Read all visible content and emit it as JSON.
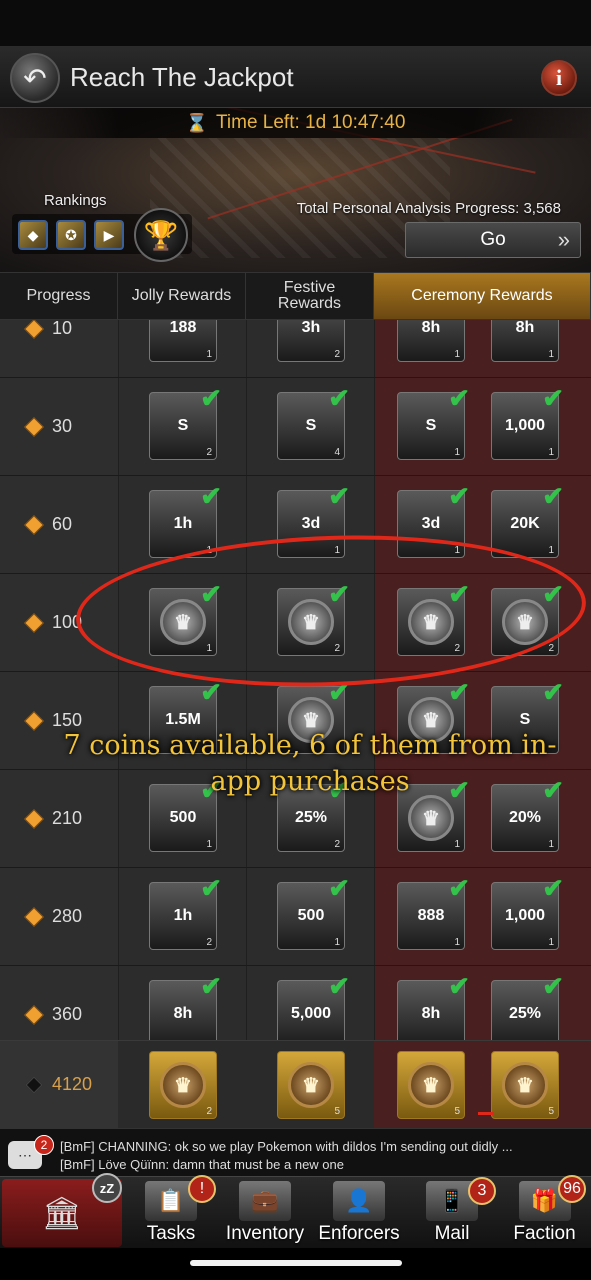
{
  "header": {
    "title": "Reach The Jackpot",
    "back_icon": "back-arrow-icon",
    "info_icon": "info-icon"
  },
  "banner": {
    "timer": "Time Left: 1d 10:47:40",
    "rankings_label": "Rankings",
    "progress_text": "Total Personal Analysis Progress: 3,568",
    "go_label": "Go"
  },
  "tabs": [
    {
      "label": "Progress"
    },
    {
      "label": "Jolly Rewards"
    },
    {
      "label": "Festive Rewards"
    },
    {
      "label": "Ceremony Rewards"
    }
  ],
  "rows": [
    {
      "threshold": "10",
      "items": [
        {
          "label": "188",
          "qty": "1",
          "claimed": true
        },
        {
          "label": "3h",
          "qty": "2",
          "claimed": true
        },
        {
          "label": "8h",
          "qty": "1",
          "claimed": true
        },
        {
          "label": "8h",
          "qty": "1",
          "claimed": true
        }
      ]
    },
    {
      "threshold": "30",
      "items": [
        {
          "label": "S",
          "qty": "2",
          "claimed": true
        },
        {
          "label": "S",
          "qty": "4",
          "claimed": true
        },
        {
          "label": "S",
          "qty": "1",
          "claimed": true
        },
        {
          "label": "1,000",
          "qty": "1",
          "claimed": true
        }
      ]
    },
    {
      "threshold": "60",
      "items": [
        {
          "label": "1h",
          "qty": "1",
          "claimed": true
        },
        {
          "label": "3d",
          "qty": "1",
          "claimed": true
        },
        {
          "label": "3d",
          "qty": "1",
          "claimed": true
        },
        {
          "label": "20K",
          "qty": "1",
          "claimed": true
        }
      ]
    },
    {
      "threshold": "100",
      "items": [
        {
          "label": "",
          "qty": "1",
          "claimed": true
        },
        {
          "label": "",
          "qty": "2",
          "claimed": true
        },
        {
          "label": "",
          "qty": "2",
          "claimed": true
        },
        {
          "label": "",
          "qty": "2",
          "claimed": true
        }
      ]
    },
    {
      "threshold": "150",
      "items": [
        {
          "label": "1.5M",
          "qty": "",
          "claimed": true
        },
        {
          "label": "",
          "qty": "",
          "claimed": true
        },
        {
          "label": "",
          "qty": "",
          "claimed": true
        },
        {
          "label": "S",
          "qty": "",
          "claimed": true
        }
      ]
    },
    {
      "threshold": "210",
      "items": [
        {
          "label": "500",
          "qty": "1",
          "claimed": true
        },
        {
          "label": "25%",
          "qty": "2",
          "claimed": true
        },
        {
          "label": "",
          "qty": "1",
          "claimed": true
        },
        {
          "label": "20%",
          "qty": "1",
          "claimed": true
        }
      ]
    },
    {
      "threshold": "280",
      "items": [
        {
          "label": "1h",
          "qty": "2",
          "claimed": true
        },
        {
          "label": "500",
          "qty": "1",
          "claimed": true
        },
        {
          "label": "888",
          "qty": "1",
          "claimed": true
        },
        {
          "label": "1,000",
          "qty": "1",
          "claimed": true
        }
      ]
    },
    {
      "threshold": "360",
      "items": [
        {
          "label": "8h",
          "qty": "",
          "claimed": true
        },
        {
          "label": "5,000",
          "qty": "",
          "claimed": true
        },
        {
          "label": "8h",
          "qty": "",
          "claimed": true
        },
        {
          "label": "25%",
          "qty": "",
          "claimed": true
        }
      ]
    }
  ],
  "final_row": {
    "threshold": "4120",
    "items": [
      {
        "qty": "2"
      },
      {
        "qty": "5"
      },
      {
        "qty": "5"
      },
      {
        "qty": "5"
      }
    ]
  },
  "annotation": {
    "text": "7 coins available, 6 of them from in-app purchases"
  },
  "chat": {
    "badge": "2",
    "line1": "[BmF] CHANNING: ok so we play Pokemon with dildos I'm sending out didly ...",
    "line2": "[BmF] Löve Qüïnn: damn that must be a new one"
  },
  "nav": {
    "home_badge": "zZ",
    "tasks": "Tasks",
    "tasks_badge": "!",
    "inventory": "Inventory",
    "enforcers": "Enforcers",
    "mail": "Mail",
    "mail_badge": "3",
    "faction": "Faction",
    "faction_badge": "96"
  },
  "colors": {
    "accent": "#d87b1c",
    "ceremony_bg": "#4a1f1f",
    "check": "#33c24a",
    "annotation": "#e0281a",
    "annotation_text": "#f2c43a"
  }
}
